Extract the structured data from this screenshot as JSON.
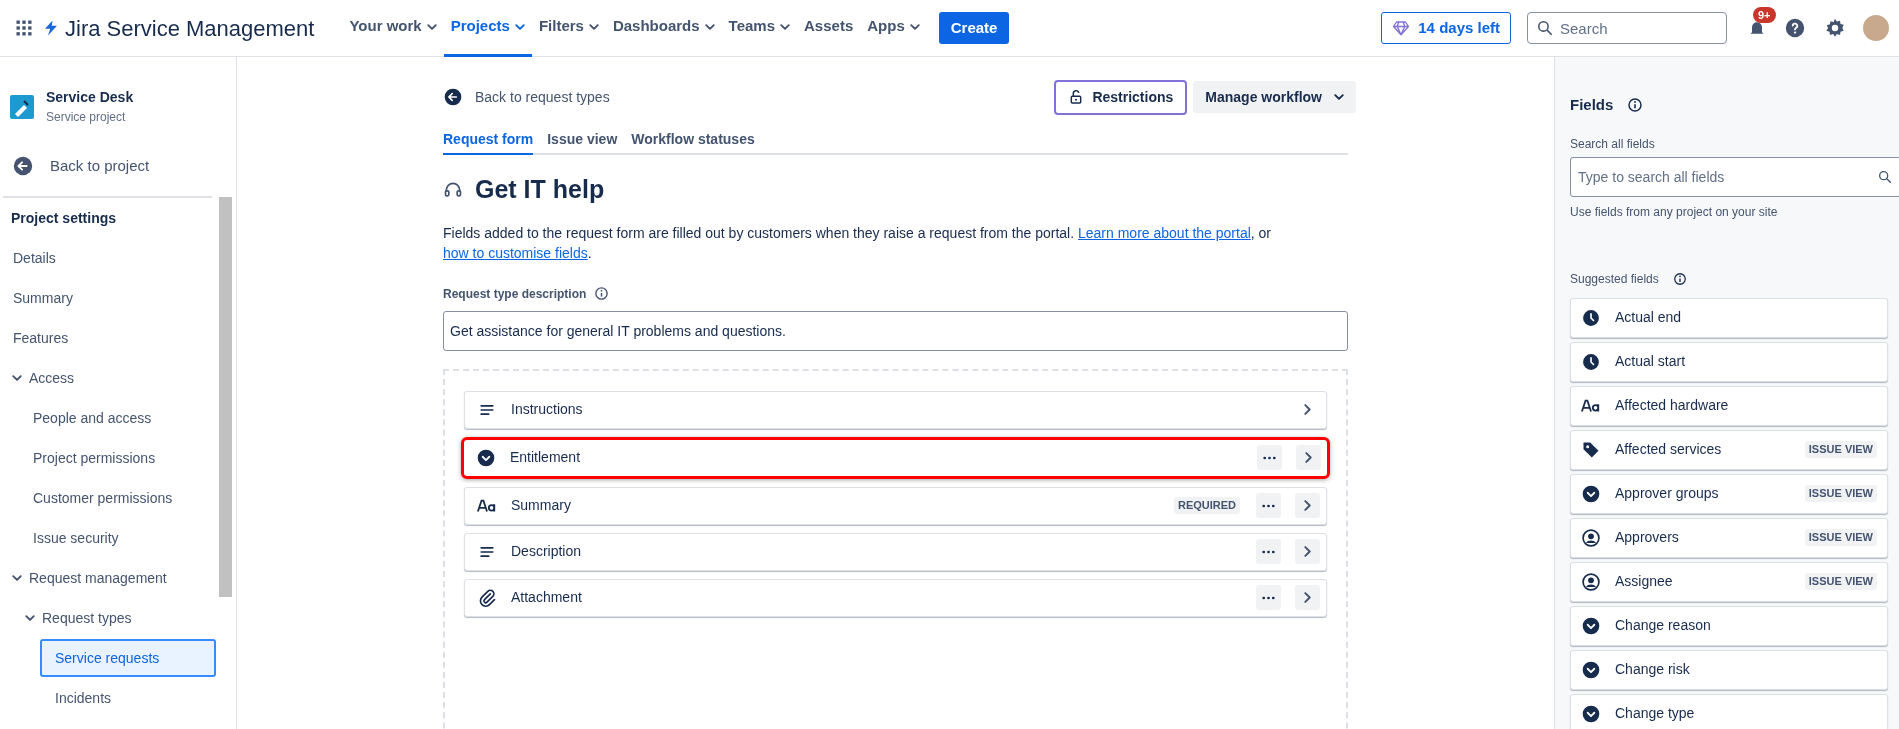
{
  "topbar": {
    "product": "Jira Service Management",
    "nav": [
      {
        "label": "Your work",
        "dropdown": true,
        "selected": false
      },
      {
        "label": "Projects",
        "dropdown": true,
        "selected": true
      },
      {
        "label": "Filters",
        "dropdown": true,
        "selected": false
      },
      {
        "label": "Dashboards",
        "dropdown": true,
        "selected": false
      },
      {
        "label": "Teams",
        "dropdown": true,
        "selected": false
      },
      {
        "label": "Assets",
        "dropdown": false,
        "selected": false
      },
      {
        "label": "Apps",
        "dropdown": true,
        "selected": false
      }
    ],
    "create": "Create",
    "trial": "14 days left",
    "search_placeholder": "Search",
    "notifications_badge": "9+"
  },
  "sidebar": {
    "project": {
      "name": "Service Desk",
      "type": "Service project"
    },
    "back": "Back to project",
    "section_title": "Project settings",
    "items": [
      {
        "label": "Details",
        "selected": false
      },
      {
        "label": "Summary",
        "selected": false
      },
      {
        "label": "Features",
        "selected": false
      },
      {
        "label": "Access",
        "selected": false,
        "expanded": true,
        "children": [
          {
            "label": "People and access",
            "selected": false
          },
          {
            "label": "Project permissions",
            "selected": false
          },
          {
            "label": "Customer permissions",
            "selected": false
          },
          {
            "label": "Issue security",
            "selected": false
          }
        ]
      },
      {
        "label": "Request management",
        "selected": false,
        "expanded": true,
        "children": [
          {
            "label": "Request types",
            "selected": false,
            "expanded": true,
            "children": [
              {
                "label": "Service requests",
                "selected": true
              },
              {
                "label": "Incidents",
                "selected": false
              }
            ]
          }
        ]
      }
    ]
  },
  "main": {
    "back_link": "Back to request types",
    "restrictions": "Restrictions",
    "manage_workflow": "Manage workflow",
    "tabs": [
      {
        "label": "Request form",
        "selected": true
      },
      {
        "label": "Issue view",
        "selected": false
      },
      {
        "label": "Workflow statuses",
        "selected": false
      }
    ],
    "title": "Get IT help",
    "intro": [
      {
        "kind": "text",
        "text": "Fields added to the request form are filled out by customers when they raise a request from the portal. "
      },
      {
        "kind": "link",
        "text": "Learn more about the portal"
      },
      {
        "kind": "text",
        "text": ", or "
      },
      {
        "kind": "link",
        "text": "how to customise fields"
      },
      {
        "kind": "text",
        "text": "."
      }
    ],
    "description_label": "Request type description",
    "description_value": "Get assistance for general IT problems and questions.",
    "form_fields": [
      {
        "label": "Instructions",
        "kind": "lines",
        "has_menu": false,
        "highlighted": false
      },
      {
        "label": "Entitlement",
        "kind": "dropdown",
        "has_menu": true,
        "highlighted": true
      },
      {
        "label": "Summary",
        "kind": "text",
        "has_menu": true,
        "highlighted": false,
        "badge": "REQUIRED"
      },
      {
        "label": "Description",
        "kind": "lines",
        "has_menu": true,
        "highlighted": false
      },
      {
        "label": "Attachment",
        "kind": "attachment",
        "has_menu": true,
        "highlighted": false
      }
    ]
  },
  "fields_panel": {
    "title": "Fields",
    "search_label": "Search all fields",
    "search_placeholder": "Type to search all fields",
    "helper": "Use fields from any project on your site",
    "suggested_title": "Suggested fields",
    "suggested": [
      {
        "label": "Actual end",
        "kind": "clock"
      },
      {
        "label": "Actual start",
        "kind": "clock"
      },
      {
        "label": "Affected hardware",
        "kind": "text"
      },
      {
        "label": "Affected services",
        "kind": "tag",
        "badge": "ISSUE VIEW"
      },
      {
        "label": "Approver groups",
        "kind": "dropdown",
        "badge": "ISSUE VIEW"
      },
      {
        "label": "Approvers",
        "kind": "person",
        "badge": "ISSUE VIEW"
      },
      {
        "label": "Assignee",
        "kind": "person",
        "badge": "ISSUE VIEW"
      },
      {
        "label": "Change reason",
        "kind": "dropdown"
      },
      {
        "label": "Change risk",
        "kind": "dropdown"
      },
      {
        "label": "Change type",
        "kind": "dropdown"
      }
    ]
  }
}
